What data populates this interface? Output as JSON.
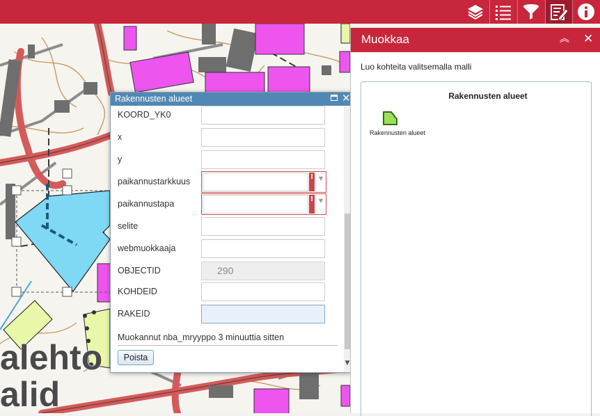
{
  "toolbar": {
    "buttons": [
      {
        "icon": "layers-icon"
      },
      {
        "icon": "list-icon"
      },
      {
        "icon": "filter-icon"
      },
      {
        "icon": "edit-icon",
        "active": true
      },
      {
        "icon": "info-icon"
      }
    ]
  },
  "map": {
    "label_line1": "alehto",
    "label_line2": "alid"
  },
  "popup": {
    "title": "Rakennusten alueet",
    "fields": [
      {
        "label": "KOORD_YK0",
        "value": ""
      },
      {
        "label": "x",
        "value": ""
      },
      {
        "label": "y",
        "value": ""
      },
      {
        "label": "paikannustarkkuus",
        "value": "",
        "type": "select",
        "required": true
      },
      {
        "label": "paikannustapa",
        "value": "",
        "type": "select",
        "required": true
      },
      {
        "label": "selite",
        "value": ""
      },
      {
        "label": "webmuokkaaja",
        "value": ""
      },
      {
        "label": "OBJECTID",
        "value": "290",
        "disabled": true
      },
      {
        "label": "KOHDEID",
        "value": ""
      },
      {
        "label": "RAKEID",
        "value": "",
        "focused": true
      }
    ],
    "error_mark": "!",
    "edited_text": "Muokannut nba_mryyppo 3 minuuttia sitten",
    "delete_label": "Poista"
  },
  "panel": {
    "title": "Muokkaa",
    "hint": "Luo kohteita valitsemalla malli",
    "template_group": "Rakennusten alueet",
    "template_item": "Rakennusten alueet"
  },
  "colors": {
    "brand": "#c8263c",
    "popup_header": "#5188b3",
    "selected_feature": "#7fd8f4",
    "template_fill": "#9ee05a"
  }
}
